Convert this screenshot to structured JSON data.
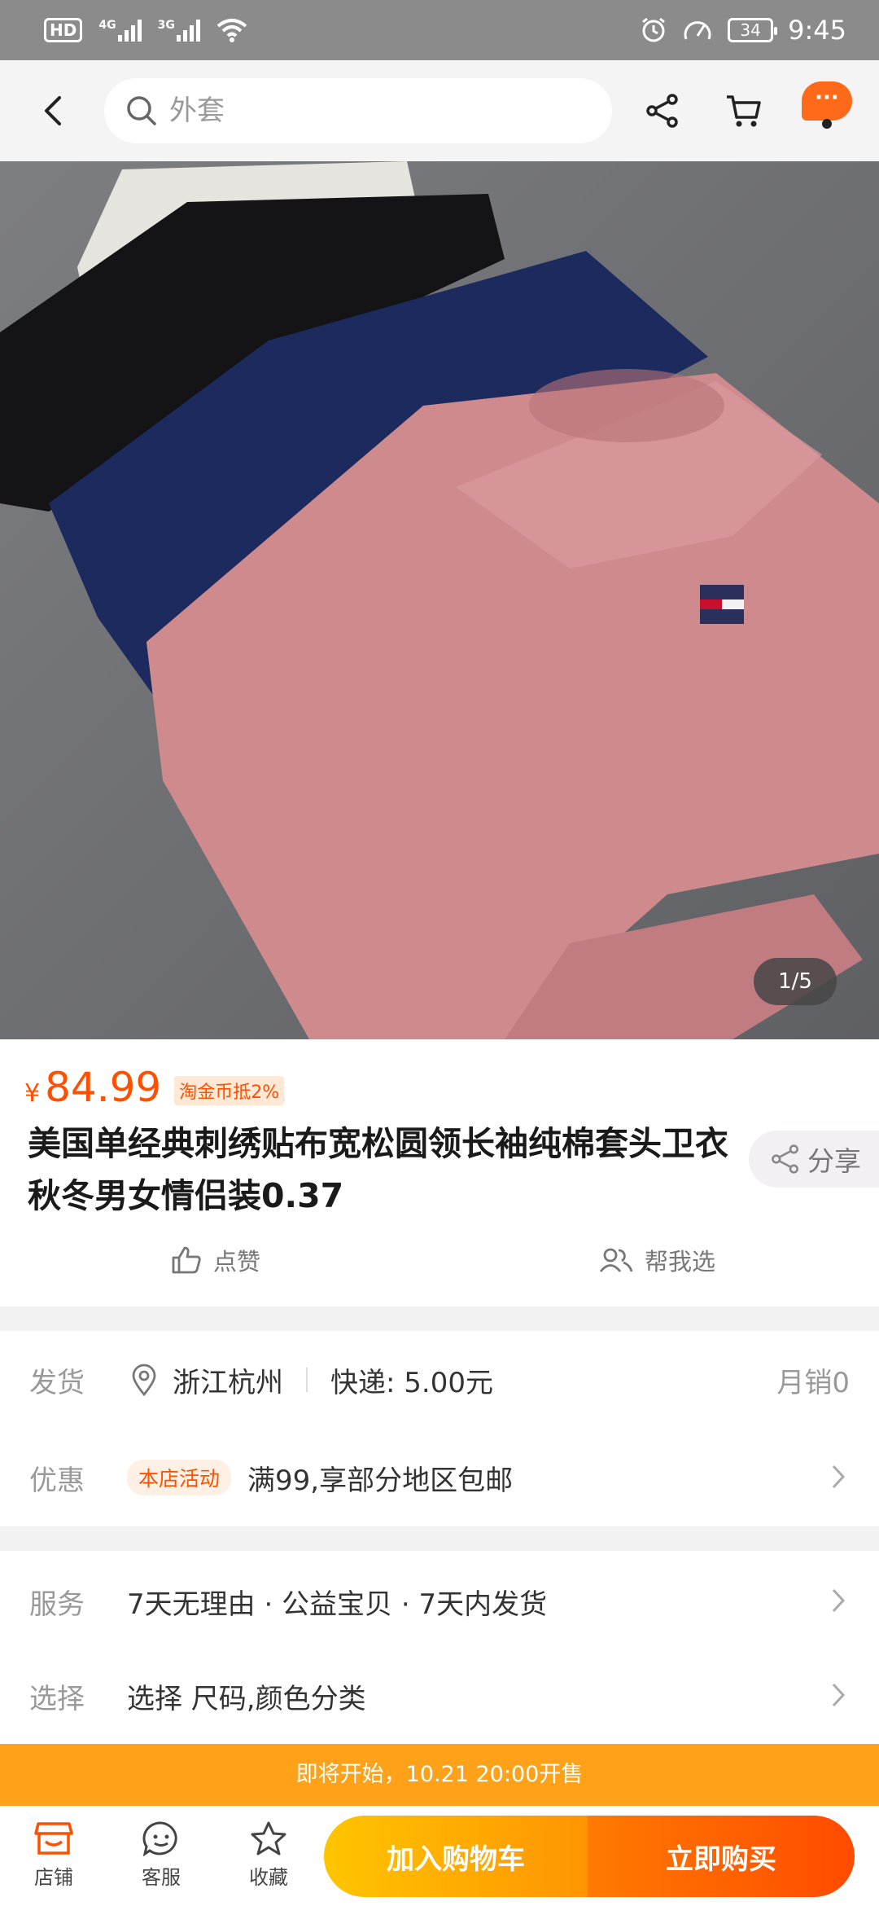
{
  "status_bar": {
    "hd_label": "HD",
    "net1": "4G",
    "net2": "3G",
    "battery": "34",
    "time": "9:45"
  },
  "top_nav": {
    "search_placeholder": "外套",
    "more_label": "···"
  },
  "gallery": {
    "counter": "1/5"
  },
  "product": {
    "currency": "¥",
    "price": "84.99",
    "coin_tag": "淘金币抵2%",
    "title": "美国单经典刺绣贴布宽松圆领长袖纯棉套头卫衣秋冬男女情侣装0.37",
    "share_label": "分享",
    "like_label": "点赞",
    "help_choose_label": "帮我选"
  },
  "delivery": {
    "label": "发货",
    "location": "浙江杭州",
    "shipping": "快递: 5.00元",
    "monthly_sales": "月销0"
  },
  "promotion": {
    "label": "优惠",
    "tag": "本店活动",
    "text": "满99,享部分地区包邮"
  },
  "service": {
    "label": "服务",
    "text": "7天无理由 · 公益宝贝 · 7天内发货"
  },
  "select": {
    "label": "选择",
    "text": "选择 尺码,颜色分类"
  },
  "presale_banner": "即将开始，10.21 20:00开售",
  "bottom_bar": {
    "shop": "店铺",
    "service": "客服",
    "favorite": "收藏",
    "add_to_cart": "加入购物车",
    "buy_now": "立即购买"
  },
  "colors": {
    "accent": "#ff5000",
    "cart_gradient_start": "#ffc500",
    "buy_gradient_end": "#ff4b00",
    "banner": "#ffa21a"
  }
}
